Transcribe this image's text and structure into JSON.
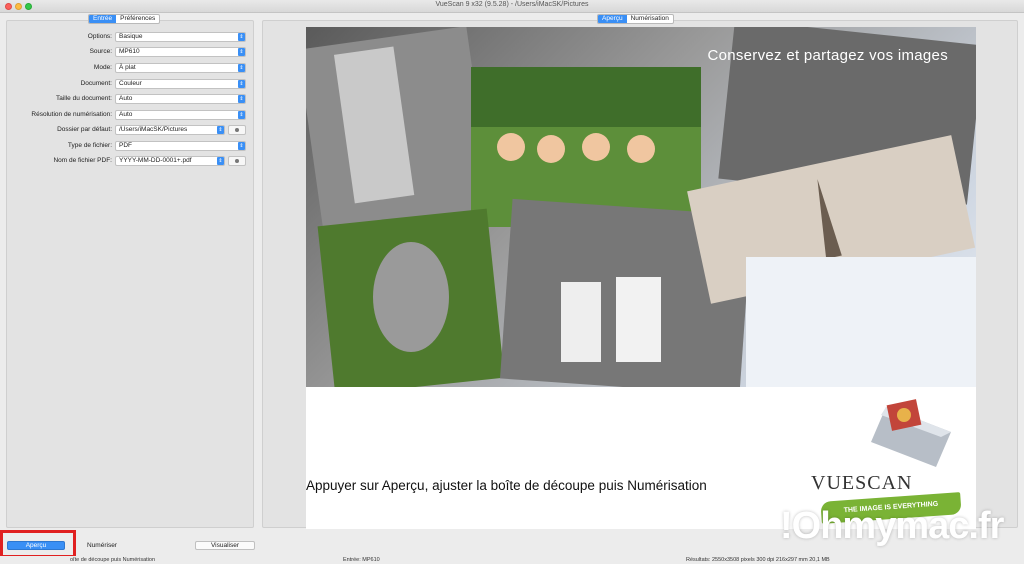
{
  "window": {
    "title": "VueScan 9 x32 (9.5.28) - /Users/iMacSK/Pictures"
  },
  "left_tabs": [
    {
      "label": "Entrée",
      "active": true
    },
    {
      "label": "Préférences",
      "active": false
    }
  ],
  "right_tabs": [
    {
      "label": "Aperçu",
      "active": true
    },
    {
      "label": "Numérisation",
      "active": false
    }
  ],
  "form": [
    {
      "label": "Options:",
      "value": "Basique"
    },
    {
      "label": "Source:",
      "value": "MP610"
    },
    {
      "label": "Mode:",
      "value": "À plat"
    },
    {
      "label": "Document:",
      "value": "Couleur"
    },
    {
      "label": "Taille du document:",
      "value": "Auto"
    },
    {
      "label": "Résolution de numérisation:",
      "value": "Auto"
    },
    {
      "label": "Dossier par défaut:",
      "value": "/Users/iMacSK/Pictures"
    },
    {
      "label": "Type de fichier:",
      "value": "PDF"
    },
    {
      "label": "Nom de fichier PDF:",
      "value": "YYYY-MM-DD-0001+.pdf"
    }
  ],
  "preview": {
    "headline": "Conservez et partagez vos images",
    "caption": "Appuyer sur Aperçu, ajuster la boîte de découpe puis Numérisation",
    "logo_name": "VUESCAN",
    "logo_tagline": "THE IMAGE IS EVERYTHING"
  },
  "buttons": {
    "preview": "Aperçu",
    "scan": "Numériser",
    "view": "Visualiser"
  },
  "status": {
    "left": "oîte de découpe puis Numérisation",
    "middle": "Entrée: MP610",
    "right": "Résultats: 2550x3508 pixels 300 dpi 216x297 mm 20,1 MB"
  },
  "watermark": "!Ohmymac.fr"
}
